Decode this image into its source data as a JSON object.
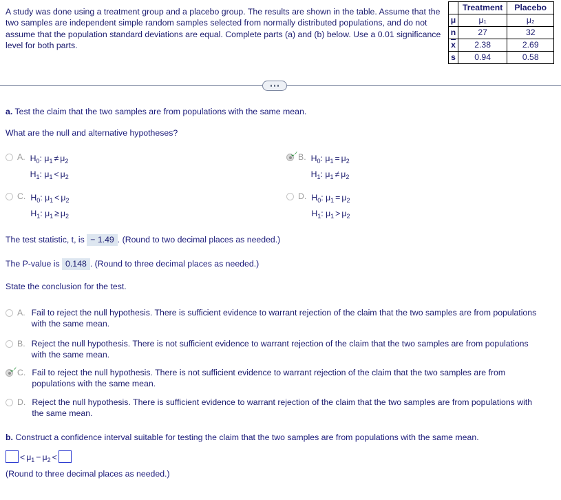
{
  "intro": {
    "text": "A study was done using a treatment group and a placebo group. The results are shown in the table. Assume that the two samples are independent simple random samples selected from normally distributed populations, and do not assume that the population standard deviations are equal. Complete parts (a) and (b) below. Use a 0.01 significance level for both parts."
  },
  "stat_table": {
    "corner": "",
    "col_headers": [
      "Treatment",
      "Placebo"
    ],
    "rows": [
      {
        "label": "μ",
        "cells": [
          "μ₁",
          "μ₂"
        ]
      },
      {
        "label": "n",
        "cells": [
          "27",
          "32"
        ]
      },
      {
        "label": "x̄",
        "cells": [
          "2.38",
          "2.69"
        ]
      },
      {
        "label": "s",
        "cells": [
          "0.94",
          "0.58"
        ]
      }
    ]
  },
  "divider": {
    "ellipsis_label": "..."
  },
  "part_a": {
    "prompt_letter": "a.",
    "prompt_text": "Test the claim that the two samples are from populations with the same mean.",
    "question": "What are the null and alternative hypotheses?",
    "options": [
      {
        "letter": "A.",
        "null_lhs": "H",
        "null_sub": "0",
        "null_mu1": "μ",
        "null_mu1sub": "1",
        "null_rel": "≠",
        "null_mu2": "μ",
        "null_mu2sub": "2",
        "alt_lhs": "H",
        "alt_sub": "1",
        "alt_mu1": "μ",
        "alt_mu1sub": "1",
        "alt_rel": "<",
        "alt_mu2": "μ",
        "alt_mu2sub": "2",
        "selected": false
      },
      {
        "letter": "B.",
        "null_lhs": "H",
        "null_sub": "0",
        "null_mu1": "μ",
        "null_mu1sub": "1",
        "null_rel": "=",
        "null_mu2": "μ",
        "null_mu2sub": "2",
        "alt_lhs": "H",
        "alt_sub": "1",
        "alt_mu1": "μ",
        "alt_mu1sub": "1",
        "alt_rel": "≠",
        "alt_mu2": "μ",
        "alt_mu2sub": "2",
        "selected": true
      },
      {
        "letter": "C.",
        "null_lhs": "H",
        "null_sub": "0",
        "null_mu1": "μ",
        "null_mu1sub": "1",
        "null_rel": "<",
        "null_mu2": "μ",
        "null_mu2sub": "2",
        "alt_lhs": "H",
        "alt_sub": "1",
        "alt_mu1": "μ",
        "alt_mu1sub": "1",
        "alt_rel": "≥",
        "alt_mu2": "μ",
        "alt_mu2sub": "2",
        "selected": false
      },
      {
        "letter": "D.",
        "null_lhs": "H",
        "null_sub": "0",
        "null_mu1": "μ",
        "null_mu1sub": "1",
        "null_rel": "=",
        "null_mu2": "μ",
        "null_mu2sub": "2",
        "alt_lhs": "H",
        "alt_sub": "1",
        "alt_mu1": "μ",
        "alt_mu1sub": "1",
        "alt_rel": ">",
        "alt_mu2": "μ",
        "alt_mu2sub": "2",
        "selected": false
      }
    ],
    "test_statistic": {
      "prefix": "The test statistic, t, is",
      "value": "− 1.49",
      "suffix": ". (Round to two decimal places as needed.)"
    },
    "p_value": {
      "prefix": "The P-value is",
      "value": "0.148",
      "suffix": ". (Round to three decimal places as needed.)"
    },
    "conclusion_prompt": "State the conclusion for the test.",
    "conclusion_options": [
      {
        "letter": "A.",
        "text": "Fail to reject the null hypothesis. There is sufficient evidence to warrant rejection of the claim that the two samples are from populations with the same mean.",
        "selected": false
      },
      {
        "letter": "B.",
        "text": "Reject the null hypothesis. There is not sufficient evidence to warrant rejection of the claim that the two samples are from populations with the same mean.",
        "selected": false
      },
      {
        "letter": "C.",
        "text": "Fail to reject the null hypothesis. There is not sufficient evidence to warrant rejection of the claim that the two samples are from populations with the same mean.",
        "selected": true
      },
      {
        "letter": "D.",
        "text": "Reject the null hypothesis. There is sufficient evidence to warrant rejection of the claim that the two samples are from populations with the same mean.",
        "selected": false
      }
    ]
  },
  "part_b": {
    "prompt_letter": "b.",
    "prompt_text": "Construct a confidence interval suitable for testing the claim that the two samples are from populations with the same mean.",
    "interval": {
      "lower_value": "",
      "upper_value": "",
      "rel_left": "<",
      "mu1": "μ",
      "mu1sub": "1",
      "minus": "−",
      "mu2": "μ",
      "mu2sub": "2",
      "rel_right": "<"
    },
    "rounding_note": "(Round to three decimal places as needed.)"
  },
  "colors": {
    "text": "#1b1b6e",
    "letter_gray": "#9a9a9a",
    "answer_fill_bg": "#dde6f0",
    "input_border": "#2b3ad0",
    "check_green": "#1a8a2e",
    "divider": "#7b86a0"
  }
}
